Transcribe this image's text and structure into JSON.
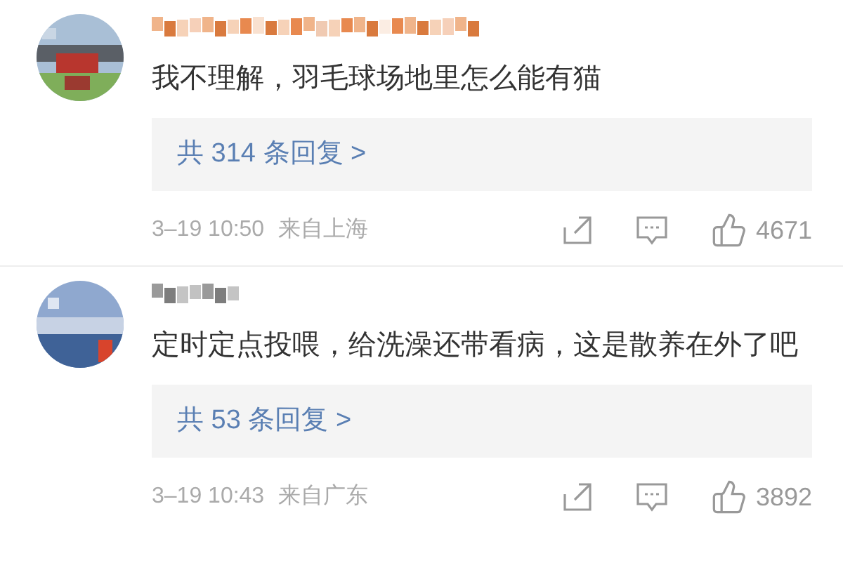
{
  "comments": [
    {
      "text": "我不理解，羽毛球场地里怎么能有猫",
      "replies": "共 314 条回复 >",
      "time": "3–19 10:50",
      "location": "来自上海",
      "likes": "4671"
    },
    {
      "text": "定时定点投喂，给洗澡还带看病，这是散养在外了吧",
      "replies": "共 53 条回复 >",
      "time": "3–19 10:43",
      "location": "来自广东",
      "likes": "3892"
    }
  ]
}
